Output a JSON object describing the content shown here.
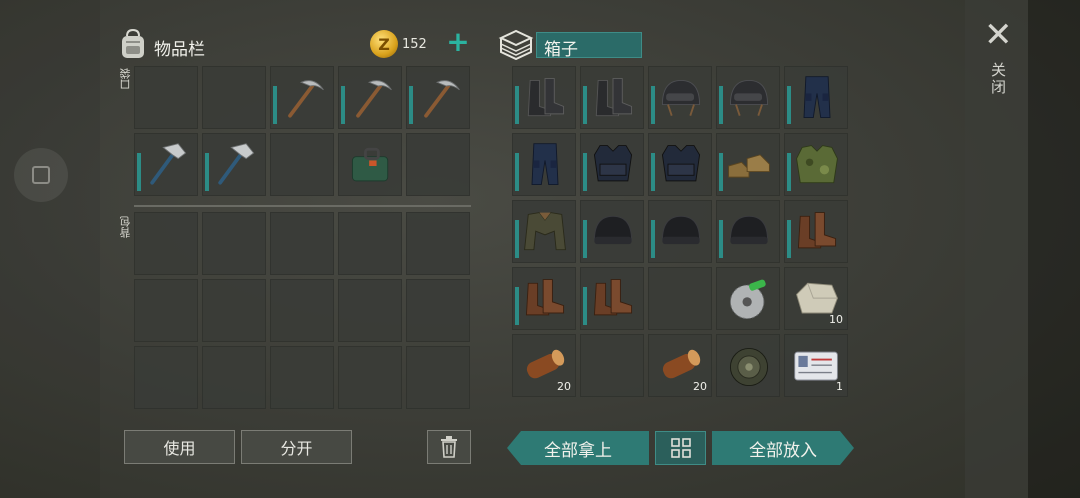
{
  "inventory": {
    "title": "物品栏",
    "coins": "152",
    "plus": "+",
    "pocket_label": "口袋",
    "backpack_label": "背包",
    "pocket_slots": [
      {
        "item": "",
        "bar": false
      },
      {
        "item": "",
        "bar": false
      },
      {
        "item": "pickaxe",
        "bar": true
      },
      {
        "item": "pickaxe",
        "bar": true
      },
      {
        "item": "pickaxe",
        "bar": true
      },
      {
        "item": "hammer",
        "bar": true
      },
      {
        "item": "hammer",
        "bar": true
      },
      {
        "item": "",
        "bar": false
      },
      {
        "item": "toolkit-bag",
        "bar": false
      },
      {
        "item": "",
        "bar": false
      }
    ],
    "backpack_slots": 15,
    "use_label": "使用",
    "split_label": "分开"
  },
  "box": {
    "title": "箱子",
    "slots": [
      {
        "item": "boots-black",
        "bar": true,
        "qty": ""
      },
      {
        "item": "boots-black",
        "bar": true,
        "qty": ""
      },
      {
        "item": "helmet",
        "bar": true,
        "qty": ""
      },
      {
        "item": "helmet",
        "bar": true,
        "qty": ""
      },
      {
        "item": "pants-blue",
        "bar": true,
        "qty": ""
      },
      {
        "item": "pants-blue",
        "bar": true,
        "qty": ""
      },
      {
        "item": "vest-tactical",
        "bar": true,
        "qty": ""
      },
      {
        "item": "vest-tactical",
        "bar": true,
        "qty": ""
      },
      {
        "item": "shoes-tan",
        "bar": true,
        "qty": ""
      },
      {
        "item": "vest-camo",
        "bar": true,
        "qty": ""
      },
      {
        "item": "jacket",
        "bar": true,
        "qty": ""
      },
      {
        "item": "beanie",
        "bar": true,
        "qty": ""
      },
      {
        "item": "beanie",
        "bar": true,
        "qty": ""
      },
      {
        "item": "beanie",
        "bar": true,
        "qty": ""
      },
      {
        "item": "boots-brown",
        "bar": true,
        "qty": ""
      },
      {
        "item": "boots-brown",
        "bar": true,
        "qty": ""
      },
      {
        "item": "boots-brown",
        "bar": true,
        "qty": ""
      },
      {
        "item": "",
        "bar": false,
        "qty": ""
      },
      {
        "item": "saw-blade",
        "bar": false,
        "qty": ""
      },
      {
        "item": "stone",
        "bar": false,
        "qty": "10"
      },
      {
        "item": "log",
        "bar": false,
        "qty": "20"
      },
      {
        "item": "",
        "bar": false,
        "qty": ""
      },
      {
        "item": "log",
        "bar": false,
        "qty": "20"
      },
      {
        "item": "landmine",
        "bar": false,
        "qty": ""
      },
      {
        "item": "id-card",
        "bar": false,
        "qty": "1"
      }
    ],
    "take_all_label": "全部拿上",
    "put_all_label": "全部放入"
  },
  "close_label": "关闭",
  "colors": {
    "accent": "#2e7a74",
    "durability": "#2c8c86"
  }
}
